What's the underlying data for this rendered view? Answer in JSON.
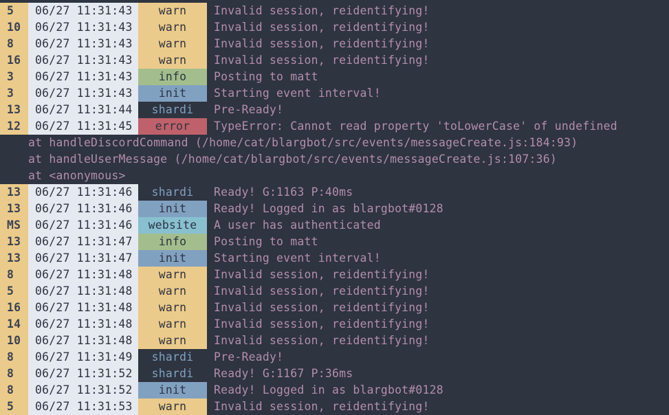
{
  "colors": {
    "background": "#2e3440",
    "shard_bg": "#ebcb8b",
    "timestamp_bg": "#e5e9f0",
    "message": "#b48ead",
    "warn_bg": "#ebcb8b",
    "info_bg": "#a3be8c",
    "init_bg": "#81a1c1",
    "error_bg": "#bf616a",
    "website_bg": "#88c0d0",
    "shardi_text": "#81a1c1"
  },
  "log": {
    "rows": [
      {
        "shard": "5",
        "time": "06/27 11:31:43",
        "level": "warn",
        "message": "Invalid session, reidentifying!"
      },
      {
        "shard": "10",
        "time": "06/27 11:31:43",
        "level": "warn",
        "message": "Invalid session, reidentifying!"
      },
      {
        "shard": "8",
        "time": "06/27 11:31:43",
        "level": "warn",
        "message": "Invalid session, reidentifying!"
      },
      {
        "shard": "16",
        "time": "06/27 11:31:43",
        "level": "warn",
        "message": "Invalid session, reidentifying!"
      },
      {
        "shard": "3",
        "time": "06/27 11:31:43",
        "level": "info",
        "message": "Posting to matt"
      },
      {
        "shard": "3",
        "time": "06/27 11:31:43",
        "level": "init",
        "message": "Starting event interval!"
      },
      {
        "shard": "13",
        "time": "06/27 11:31:44",
        "level": "shardi",
        "message": "Pre-Ready!"
      },
      {
        "shard": "12",
        "time": "06/27 11:31:45",
        "level": "error",
        "message": "TypeError: Cannot read property 'toLowerCase' of undefined"
      },
      {
        "shard": "13",
        "time": "06/27 11:31:46",
        "level": "shardi",
        "message": "Ready! G:1163 P:40ms"
      },
      {
        "shard": "13",
        "time": "06/27 11:31:46",
        "level": "init",
        "message": "Ready! Logged in as blargbot#0128"
      },
      {
        "shard": "MS",
        "time": "06/27 11:31:46",
        "level": "website",
        "message": "A user has authenticated"
      },
      {
        "shard": "13",
        "time": "06/27 11:31:47",
        "level": "info",
        "message": "Posting to matt"
      },
      {
        "shard": "13",
        "time": "06/27 11:31:47",
        "level": "init",
        "message": "Starting event interval!"
      },
      {
        "shard": "8",
        "time": "06/27 11:31:48",
        "level": "warn",
        "message": "Invalid session, reidentifying!"
      },
      {
        "shard": "5",
        "time": "06/27 11:31:48",
        "level": "warn",
        "message": "Invalid session, reidentifying!"
      },
      {
        "shard": "16",
        "time": "06/27 11:31:48",
        "level": "warn",
        "message": "Invalid session, reidentifying!"
      },
      {
        "shard": "14",
        "time": "06/27 11:31:48",
        "level": "warn",
        "message": "Invalid session, reidentifying!"
      },
      {
        "shard": "10",
        "time": "06/27 11:31:48",
        "level": "warn",
        "message": "Invalid session, reidentifying!"
      },
      {
        "shard": "8",
        "time": "06/27 11:31:49",
        "level": "shardi",
        "message": "Pre-Ready!"
      },
      {
        "shard": "8",
        "time": "06/27 11:31:52",
        "level": "shardi",
        "message": "Ready! G:1167 P:36ms"
      },
      {
        "shard": "8",
        "time": "06/27 11:31:52",
        "level": "init",
        "message": "Ready! Logged in as blargbot#0128"
      },
      {
        "shard": "5",
        "time": "06/27 11:31:53",
        "level": "warn",
        "message": "Invalid session, reidentifying!"
      }
    ],
    "stack_trace": [
      "at handleDiscordCommand (/home/cat/blargbot/src/events/messageCreate.js:184:93)",
      "at handleUserMessage (/home/cat/blargbot/src/events/messageCreate.js:107:36)",
      "at <anonymous>"
    ]
  }
}
